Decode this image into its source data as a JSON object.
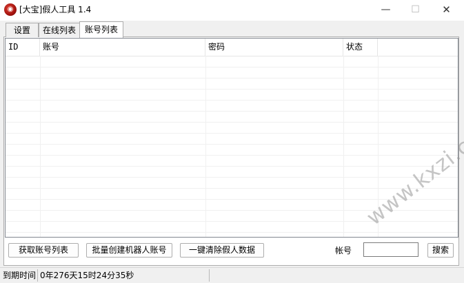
{
  "window": {
    "title": "[大宝]假人工具 1.4",
    "icon": "app-logo-icon",
    "controls": {
      "minimize": "—",
      "maximize": "☐",
      "close": "✕"
    }
  },
  "tabs": [
    {
      "label": "设置",
      "active": false
    },
    {
      "label": "在线列表",
      "active": false
    },
    {
      "label": "账号列表",
      "active": true
    }
  ],
  "list": {
    "columns": [
      "ID",
      "账号",
      "密码",
      "状态"
    ],
    "rows": []
  },
  "actions": {
    "get_accounts": "获取账号列表",
    "batch_create": "批量创建机器人账号",
    "clear_fake_data": "一键清除假人数据",
    "account_label": "帐号",
    "account_value": "",
    "search": "搜索"
  },
  "status": {
    "label": "到期时间",
    "value": "0年276天15时24分35秒"
  },
  "watermark": "www.kxzi.cn",
  "colors": {
    "window_bg": "#f0f0f0",
    "border": "#adadad",
    "list_border": "#828790"
  }
}
